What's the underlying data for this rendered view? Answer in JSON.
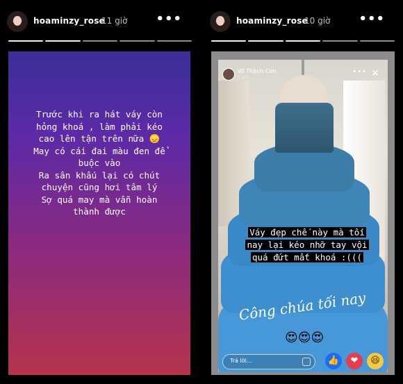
{
  "left_story": {
    "username": "hoaminzy_rose",
    "time": "11 giờ",
    "text": "Trước khi ra hát váy còn\nhỏng khoá , làm phải kéo\ncao lên tận trên nữa 😞\nMay có cái đai màu đen để\nbuộc vào\nRa sân khấu lại có chút\nchuyện cũng hơi tâm lý\nSợ quá may mà vẫn hoàn\nthành được",
    "progress_segments": 5,
    "progress_done": 2
  },
  "right_story": {
    "username": "hoaminzy_rose",
    "time": "10 giờ",
    "progress_segments": 5,
    "progress_done": 3,
    "embedded": {
      "poster_name": "Võ Thành Cơn",
      "poster_time": "1 giờ",
      "caption_lines": [
        "Váy đẹp chế này mà tối",
        "nay lại kéo nhỡ tay vội",
        "quá đứt mất khoá :((("
      ],
      "script_text": "Công chúa tối nay",
      "emojis": "😍😍😍",
      "reply_placeholder": "Trả lời...",
      "reactions": {
        "like": "👍",
        "love": "❤",
        "haha": "😆"
      }
    }
  },
  "icons": {
    "more": "•••",
    "close": "✕",
    "mini_more": "•••"
  }
}
